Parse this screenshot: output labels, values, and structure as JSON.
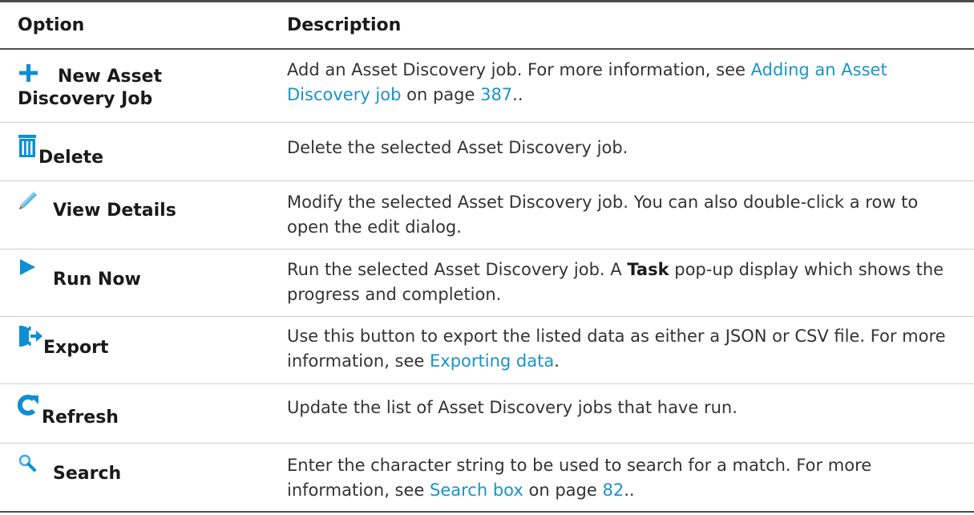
{
  "header": {
    "option": "Option",
    "description": "Description"
  },
  "colors": {
    "link": "#1b93c8",
    "icon": "#0c8fd4"
  },
  "rows": [
    {
      "icon": "plus-icon",
      "label_line1": "New Asset",
      "label_line2": "Discovery Job",
      "desc_pre": "Add an Asset Discovery job. For more information, see ",
      "desc_link": "Adding an Asset Discovery job",
      "desc_mid": " on page ",
      "desc_page": "387",
      "desc_post": ".."
    },
    {
      "icon": "trash-icon",
      "label": "Delete",
      "desc": "Delete the selected Asset Discovery job."
    },
    {
      "icon": "pencil-icon",
      "label": "View Details",
      "desc": "Modify the selected Asset Discovery job. You can also double-click a row to open the edit dialog."
    },
    {
      "icon": "play-icon",
      "label": "Run Now",
      "desc_pre": "Run the selected Asset Discovery job. A ",
      "desc_bold": "Task",
      "desc_post": " pop-up display which shows the progress and completion."
    },
    {
      "icon": "export-icon",
      "label": "Export",
      "desc_pre": "Use this button to export the listed data as either a JSON or CSV file. For more information, see ",
      "desc_link": "Exporting data",
      "desc_post": "."
    },
    {
      "icon": "refresh-icon",
      "label": "Refresh",
      "desc": "Update the list of Asset Discovery jobs that have run."
    },
    {
      "icon": "search-icon",
      "label": "Search",
      "desc_pre": "Enter the character string to be used to search for a match. For more information, see ",
      "desc_link": "Search box",
      "desc_mid": " on page ",
      "desc_page": "82",
      "desc_post": ".."
    }
  ]
}
